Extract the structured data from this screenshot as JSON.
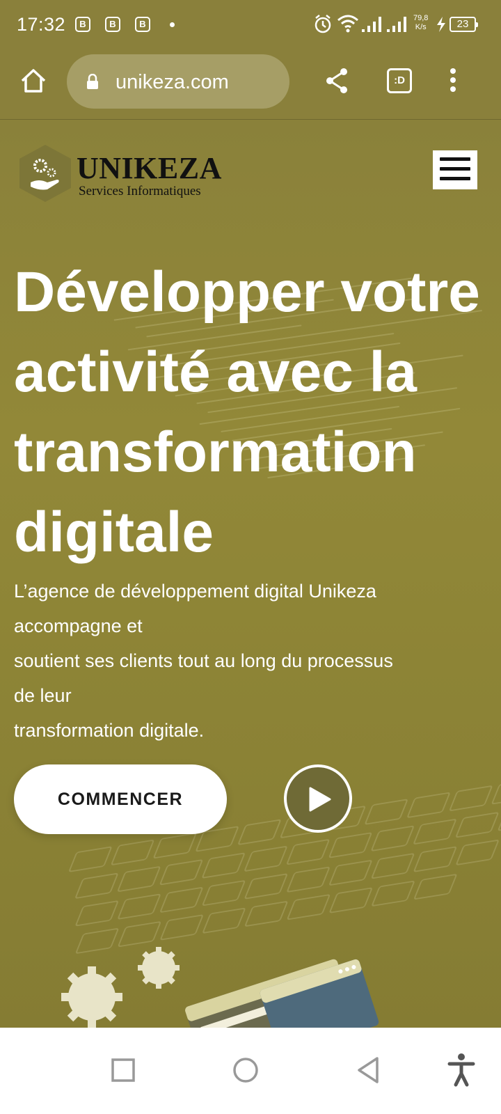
{
  "status_bar": {
    "time": "17:32",
    "speed_value": "79,8",
    "speed_unit": "K/s",
    "battery": "23",
    "notification_icons": [
      "b-coin-icon",
      "b-coin-icon",
      "b-coin-icon"
    ]
  },
  "browser": {
    "url": "unikeza.com",
    "tab_label": ":D"
  },
  "header": {
    "logo_name": "UNIKEZA",
    "logo_subtitle": "Services Informatiques"
  },
  "hero": {
    "title_lines": [
      "Développer votre",
      "activité avec la",
      "transformation",
      "digitale"
    ],
    "text_lines": [
      "L’agence de développement digital Unikeza",
      "accompagne et",
      "soutient ses clients tout au long du processus",
      "de leur",
      "transformation digitale."
    ],
    "cta_label": "COMMENCER"
  },
  "colors": {
    "overlay": "#8c8336",
    "text": "#ffffff",
    "cta_bg": "#ffffff",
    "play_bg": "#6f6a36"
  }
}
